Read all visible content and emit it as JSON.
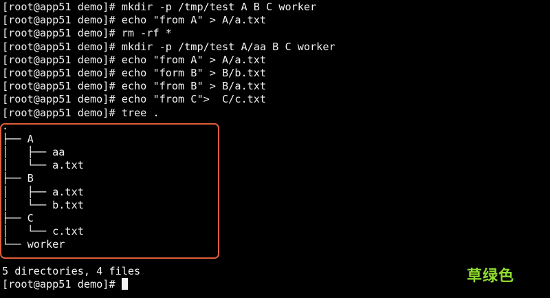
{
  "terminal": {
    "lines": [
      "[root@app51 demo]# mkdir -p /tmp/test A B C worker",
      "[root@app51 demo]# echo \"from A\" > A/a.txt",
      "[root@app51 demo]# rm -rf *",
      "[root@app51 demo]# mkdir -p /tmp/test A/aa B C worker",
      "[root@app51 demo]# echo \"from A\" > A/a.txt",
      "[root@app51 demo]# echo \"form B\" > B/b.txt",
      "[root@app51 demo]# echo \"from B\" > B/a.txt",
      "[root@app51 demo]# echo \"from C\">  C/c.txt",
      "[root@app51 demo]# tree ."
    ],
    "tree": [
      ".",
      "├── A",
      "│   ├── aa",
      "│   └── a.txt",
      "├── B",
      "│   ├── a.txt",
      "│   └── b.txt",
      "├── C",
      "│   └── c.txt",
      "└── worker"
    ],
    "blank": "",
    "summary": "5 directories, 4 files",
    "prompt": "[root@app51 demo]# "
  },
  "colors": {
    "background": "#000000",
    "text": "#f2f2f2",
    "highlight_box": "#e35f3a",
    "watermark": "#8fdc2f"
  },
  "watermark": {
    "text": "草绿色"
  }
}
